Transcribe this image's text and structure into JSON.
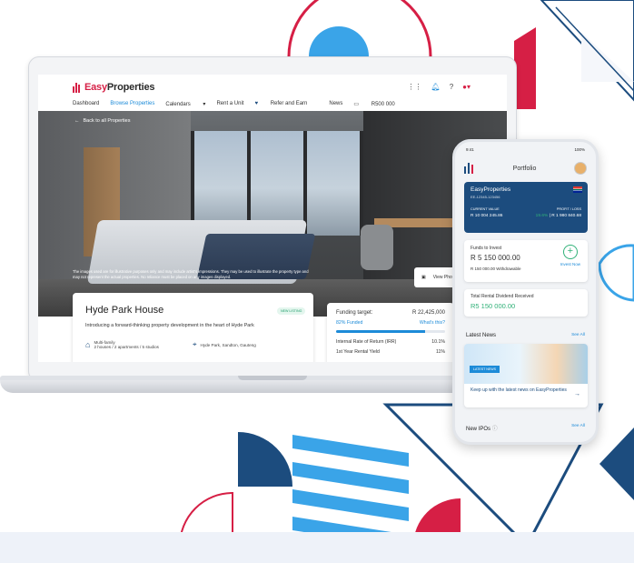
{
  "web": {
    "logo": {
      "brand_a": "Easy",
      "brand_b": "Properties"
    },
    "nav": [
      "Dashboard",
      "Browse Properties",
      "Calendars",
      "Rent a Unit",
      "Refer and Earn",
      "News",
      "R500 000"
    ],
    "back_link": "Back to all Properties",
    "disclaimer": "The images used are for illustrative purposes only and may include artist's impressions. They may be used to illustrate the property type and may not represent the actual properties. No reliance must be placed on any images displayed.",
    "view_photos": "View Photos",
    "property": {
      "title": "Hyde Park House",
      "badge": "NEW LISTING",
      "description": "Introducing a forward-thinking property development in the heart of Hyde Park",
      "type_label": "Multi-family",
      "units": "2 houses / 2 apartments / 5 studios",
      "location": "Hyde Park, Sandton, Gauteng"
    },
    "funding": {
      "target_label": "Funding target:",
      "target_value": "R 22,425,000",
      "funded_label": "82% Funded",
      "funded_fraction": 0.82,
      "whats_this": "What's this?",
      "irr_label": "Internal Rate of Return (IRR)",
      "irr_value": "10.1%",
      "yield_label": "1st Year Rental Yield",
      "yield_value": "11%"
    }
  },
  "phone": {
    "status_time": "9:41",
    "status_battery": "100%",
    "title": "Portfolio",
    "account": {
      "name": "EasyProperties",
      "number": "EE-12345-123456",
      "current_value_label": "CURRENT VALUE",
      "current_value": "R 10 004 245.86",
      "profit_label": "PROFIT / LOSS",
      "profit_pct": "19.6%",
      "profit_value": "R 1 980 840.68"
    },
    "funds": {
      "label": "Funds to Invest",
      "value": "R 5 150 000.00",
      "withdrawable": "R 150 000.00",
      "withdrawable_label": "Withdrawable",
      "invest_now": "Invest Now"
    },
    "dividend": {
      "label": "Total Rental Dividend Received",
      "value": "R5 150 000.00"
    },
    "latest_news": {
      "title": "Latest News",
      "see_all": "See All",
      "tag": "LATEST NEWS",
      "headline": "Keep up with the latest news on EasyProperties"
    },
    "new_ipos": {
      "title": "New IPOs",
      "see_all": "See All"
    }
  },
  "colors": {
    "brand_red": "#d61f45",
    "brand_navy": "#1c4c7e",
    "accent_blue": "#1d8bd8",
    "light_blue": "#3aa4e8",
    "green": "#30b178"
  }
}
